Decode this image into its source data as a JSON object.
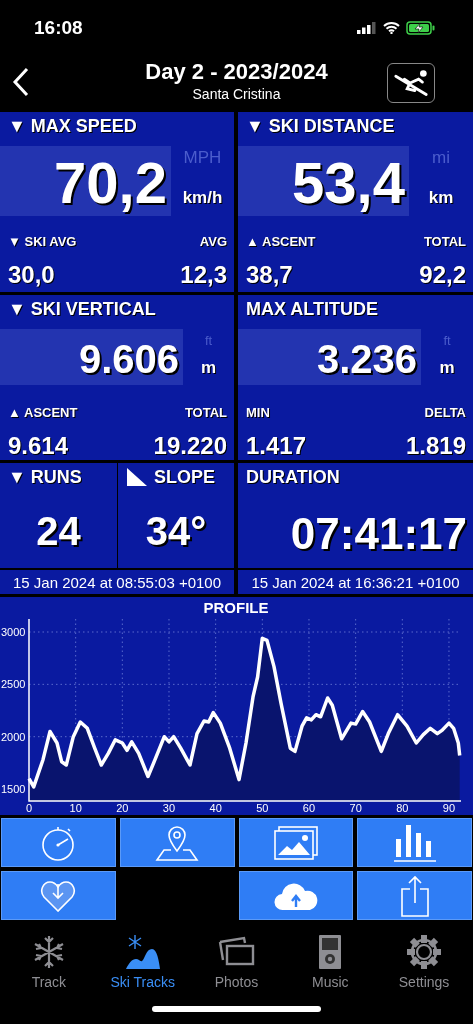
{
  "status_bar": {
    "time": "16:08"
  },
  "nav": {
    "title": "Day 2 - 2023/2024",
    "subtitle": "Santa Cristina"
  },
  "stats": [
    {
      "kind": "big",
      "title": "▼ MAX SPEED",
      "value": "70,2",
      "unit_alt": "MPH",
      "unit": "km/h",
      "left_label": "▼ SKI AVG",
      "right_label": "AVG",
      "left_value": "30,0",
      "right_value": "12,3"
    },
    {
      "kind": "big",
      "title": "▼ SKI DISTANCE",
      "value": "53,4",
      "unit_alt": "mi",
      "unit": "km",
      "left_label": "▲ ASCENT",
      "right_label": "TOTAL",
      "left_value": "38,7",
      "right_value": "92,2"
    },
    {
      "kind": "medium",
      "title": "▼ SKI VERTICAL",
      "value": "9.606",
      "unit_alt": "ft",
      "unit": "m",
      "left_label": "▲ ASCENT",
      "right_label": "TOTAL",
      "left_value": "9.614",
      "right_value": "19.220"
    },
    {
      "kind": "medium",
      "title": "MAX ALTITUDE",
      "value": "3.236",
      "unit_alt": "ft",
      "unit": "m",
      "left_label": "MIN",
      "right_label": "DELTA",
      "left_value": "1.417",
      "right_value": "1.819"
    }
  ],
  "counts": [
    {
      "kind": "plain",
      "title": "▼ RUNS",
      "value": "24"
    },
    {
      "kind": "slope",
      "title": "SLOPE",
      "value": "34°"
    }
  ],
  "duration": {
    "title": "DURATION",
    "value": "07:41:17"
  },
  "times": {
    "start": "15 Jan 2024 at 08:55:03 +0100",
    "end": "15 Jan 2024 at 16:36:21 +0100"
  },
  "profile": {
    "chart_data": {
      "type": "area",
      "title": "PROFILE",
      "grid": true,
      "xlim": [
        0,
        92.3
      ],
      "ylim": [
        1380,
        3130
      ],
      "xticks": [
        0,
        10,
        20,
        30,
        40,
        50,
        60,
        70,
        80,
        90
      ],
      "yticks": [
        1500,
        2000,
        2500,
        3000
      ],
      "x": [
        0,
        1,
        3,
        4.5,
        6,
        7,
        8,
        9.5,
        11,
        12.5,
        14,
        15.5,
        17,
        18.5,
        20,
        21,
        22,
        23.5,
        25.5,
        27,
        29,
        30,
        31,
        32.5,
        34.5,
        36,
        37.5,
        38.5,
        39.5,
        41,
        43,
        45,
        46.5,
        48,
        49,
        50,
        51,
        52.5,
        54,
        56,
        57,
        58.5,
        59.5,
        60.5,
        61.5,
        62.5,
        64,
        65,
        67,
        69,
        70,
        71.5,
        73,
        75.5,
        77,
        79,
        81,
        83,
        84.5,
        86,
        87.5,
        88.5,
        90,
        91,
        92,
        92.3
      ],
      "series": [
        {
          "color": "#ffffff",
          "values": [
            1600,
            1520,
            1780,
            2050,
            1940,
            1760,
            1730,
            2000,
            2140,
            2080,
            1900,
            1730,
            1840,
            1970,
            1940,
            1870,
            1950,
            1840,
            1620,
            1780,
            2000,
            1950,
            2000,
            1890,
            1730,
            2030,
            2150,
            2140,
            2230,
            2130,
            1890,
            1590,
            1940,
            2380,
            2570,
            2940,
            2920,
            2670,
            2320,
            1890,
            1860,
            2100,
            2180,
            2160,
            2210,
            2190,
            2370,
            2300,
            1980,
            2130,
            2120,
            2240,
            2140,
            1860,
            2030,
            2210,
            2100,
            1940,
            2020,
            2080,
            2030,
            2060,
            2130,
            2080,
            1940,
            1820
          ]
        }
      ]
    }
  },
  "tabs": [
    {
      "label": "Track",
      "selected": false
    },
    {
      "label": "Ski Tracks",
      "selected": true
    },
    {
      "label": "Photos",
      "selected": false
    },
    {
      "label": "Music",
      "selected": false
    },
    {
      "label": "Settings",
      "selected": false
    }
  ]
}
